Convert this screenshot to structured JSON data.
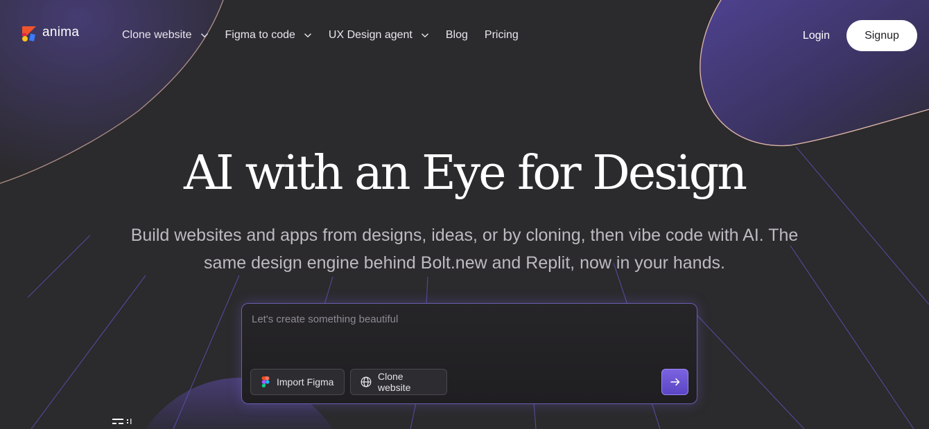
{
  "brand": {
    "name": "anima"
  },
  "nav": {
    "items": [
      {
        "label": "Clone website",
        "has_dropdown": true
      },
      {
        "label": "Figma to code",
        "has_dropdown": true
      },
      {
        "label": "UX Design agent",
        "has_dropdown": true
      },
      {
        "label": "Blog",
        "has_dropdown": false
      },
      {
        "label": "Pricing",
        "has_dropdown": false
      }
    ],
    "login_label": "Login",
    "signup_label": "Signup"
  },
  "hero": {
    "title": "AI with an Eye for Design",
    "subtitle_line1": "Build websites and apps from designs, ideas, or by cloning, then vibe code with AI. The",
    "subtitle_line2": "same design engine behind Bolt.new and Replit, now in your hands."
  },
  "prompt": {
    "placeholder": "Let's create something beautiful",
    "value": "",
    "import_figma_label": "Import Figma",
    "clone_website_label": "Clone website",
    "send_icon": "arrow-right-icon"
  },
  "colors": {
    "background": "#2b2a2c",
    "accent": "#6a55d6",
    "signup_bg": "#ffffff",
    "subtitle": "#bdbac2"
  }
}
